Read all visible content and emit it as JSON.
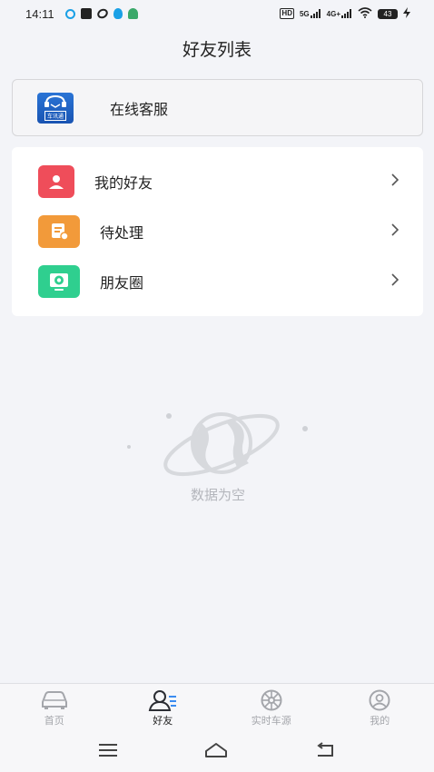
{
  "status_bar": {
    "time": "14:11",
    "hd_label": "HD",
    "signal_1": "5G",
    "signal_2": "4G+",
    "battery": "43"
  },
  "header": {
    "title": "好友列表"
  },
  "service": {
    "label": "在线客服",
    "logo_text": "车讯通"
  },
  "menu": {
    "items": [
      {
        "label": "我的好友",
        "icon": "friends-icon",
        "color": "#ef4d5a"
      },
      {
        "label": "待处理",
        "icon": "pending-icon",
        "color": "#f29a3a"
      },
      {
        "label": "朋友圈",
        "icon": "moments-icon",
        "color": "#2fcf8f"
      }
    ]
  },
  "empty_state": {
    "text": "数据为空"
  },
  "bottom_nav": {
    "items": [
      {
        "label": "首页",
        "icon": "car-icon",
        "active": false
      },
      {
        "label": "好友",
        "icon": "friends-nav-icon",
        "active": true
      },
      {
        "label": "实时车源",
        "icon": "wheel-icon",
        "active": false
      },
      {
        "label": "我的",
        "icon": "profile-icon",
        "active": false
      }
    ]
  },
  "colors": {
    "background": "#f3f4f8",
    "card": "#ffffff",
    "text_primary": "#222222",
    "text_muted": "#a4a6ab"
  }
}
